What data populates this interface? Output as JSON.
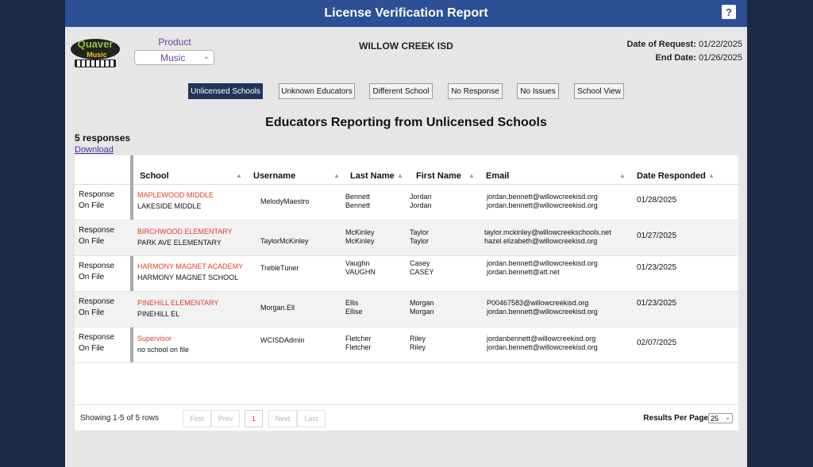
{
  "header": {
    "title": "License Verification Report",
    "help_label": "?"
  },
  "logo": {
    "line1": "Quaver",
    "line2": "Music"
  },
  "product": {
    "label": "Product",
    "selected": "Music"
  },
  "district": "WILLOW CREEK ISD",
  "dates": {
    "request_label": "Date of Request:",
    "request_value": "01/22/2025",
    "end_label": "End Date:",
    "end_value": "01/26/2025"
  },
  "filters": [
    "Unlicensed Schools",
    "Unknown Educators",
    "Different School",
    "No Response",
    "No Issues",
    "School View"
  ],
  "section_title": "Educators Reporting from Unlicensed Schools",
  "responses_count": "5 responses",
  "download_label": "Download",
  "columns": [
    "School",
    "Username",
    "Last Name",
    "First Name",
    "Email",
    "Date Responded"
  ],
  "rows": [
    {
      "status1": "Response",
      "status2": "On File",
      "school1": "MAPLEWOOD MIDDLE",
      "school2": "LAKESIDE MIDDLE",
      "username": "MelodyMaestro",
      "last1": "Bennett",
      "last2": "Bennett",
      "first1": "Jordan",
      "first2": "Jordan",
      "email1": "jordan.bennett@willowcreekisd.org",
      "email2": "jordan.bennett@willowcreekisd.org",
      "date": "01/28/2025"
    },
    {
      "status1": "Response",
      "status2": "On File",
      "school1": "BIRCHWOOD ELEMENTARY",
      "school2": "PARK AVE ELEMENTARY",
      "username": "TaylorMcKinley",
      "last1": "McKinley",
      "last2": "McKinley",
      "first1": "Taylor",
      "first2": "Taylor",
      "email1": "taylor.mckinley@willowcreekschools.net",
      "email2": "hazel.elizabeth@willowcreekisd.org",
      "date": "01/27/2025"
    },
    {
      "status1": "Response",
      "status2": "On File",
      "school1": "HARMONY MAGNET ACADEMY",
      "school2": "HARMONY MAGNET SCHOOL",
      "username": "TrebleTuner",
      "last1": "Vaughn",
      "last2": "VAUGHN",
      "first1": "Casey",
      "first2": "CASEY",
      "email1": "jordan.bennett@willowcreekisd.org",
      "email2": "jordan.bennett@att.net",
      "date": "01/23/2025"
    },
    {
      "status1": "Response",
      "status2": "On File",
      "school1": "PINEHILL ELEMENTARY",
      "school2": "PINEHILL EL",
      "username": "Morgan.Ell",
      "last1": "Ellis",
      "last2": "Ellise",
      "first1": "Morgan",
      "first2": "Morgan",
      "email1": "P00467583@willowcreekisd.org",
      "email2": "jordan.bennett@willowcreekisd.org",
      "date": "01/23/2025"
    },
    {
      "status1": "Response",
      "status2": "On File",
      "school1": "Supervisor",
      "school2": "no school on file",
      "username": "WCISDAdmin",
      "last1": "Fletcher",
      "last2": "Fletcher",
      "first1": "Riley",
      "first2": "Riley",
      "email1": "jordanbennett@willowcreekisd.org",
      "email2": "jordan.bennett@willowcreekisd.org",
      "date": "02/07/2025"
    }
  ],
  "pagination": {
    "showing": "Showing 1-5 of 5 rows",
    "first": "First",
    "prev": "Prev",
    "current": "1",
    "next": "Next",
    "last": "Last",
    "per_page_label": "Results Per Page",
    "per_page_value": "25"
  },
  "colors": {
    "header_bar": "#2c4f96",
    "active_filter": "#1f3658",
    "school_highlight": "#e03a2e",
    "product_text": "#6a3fa0"
  }
}
